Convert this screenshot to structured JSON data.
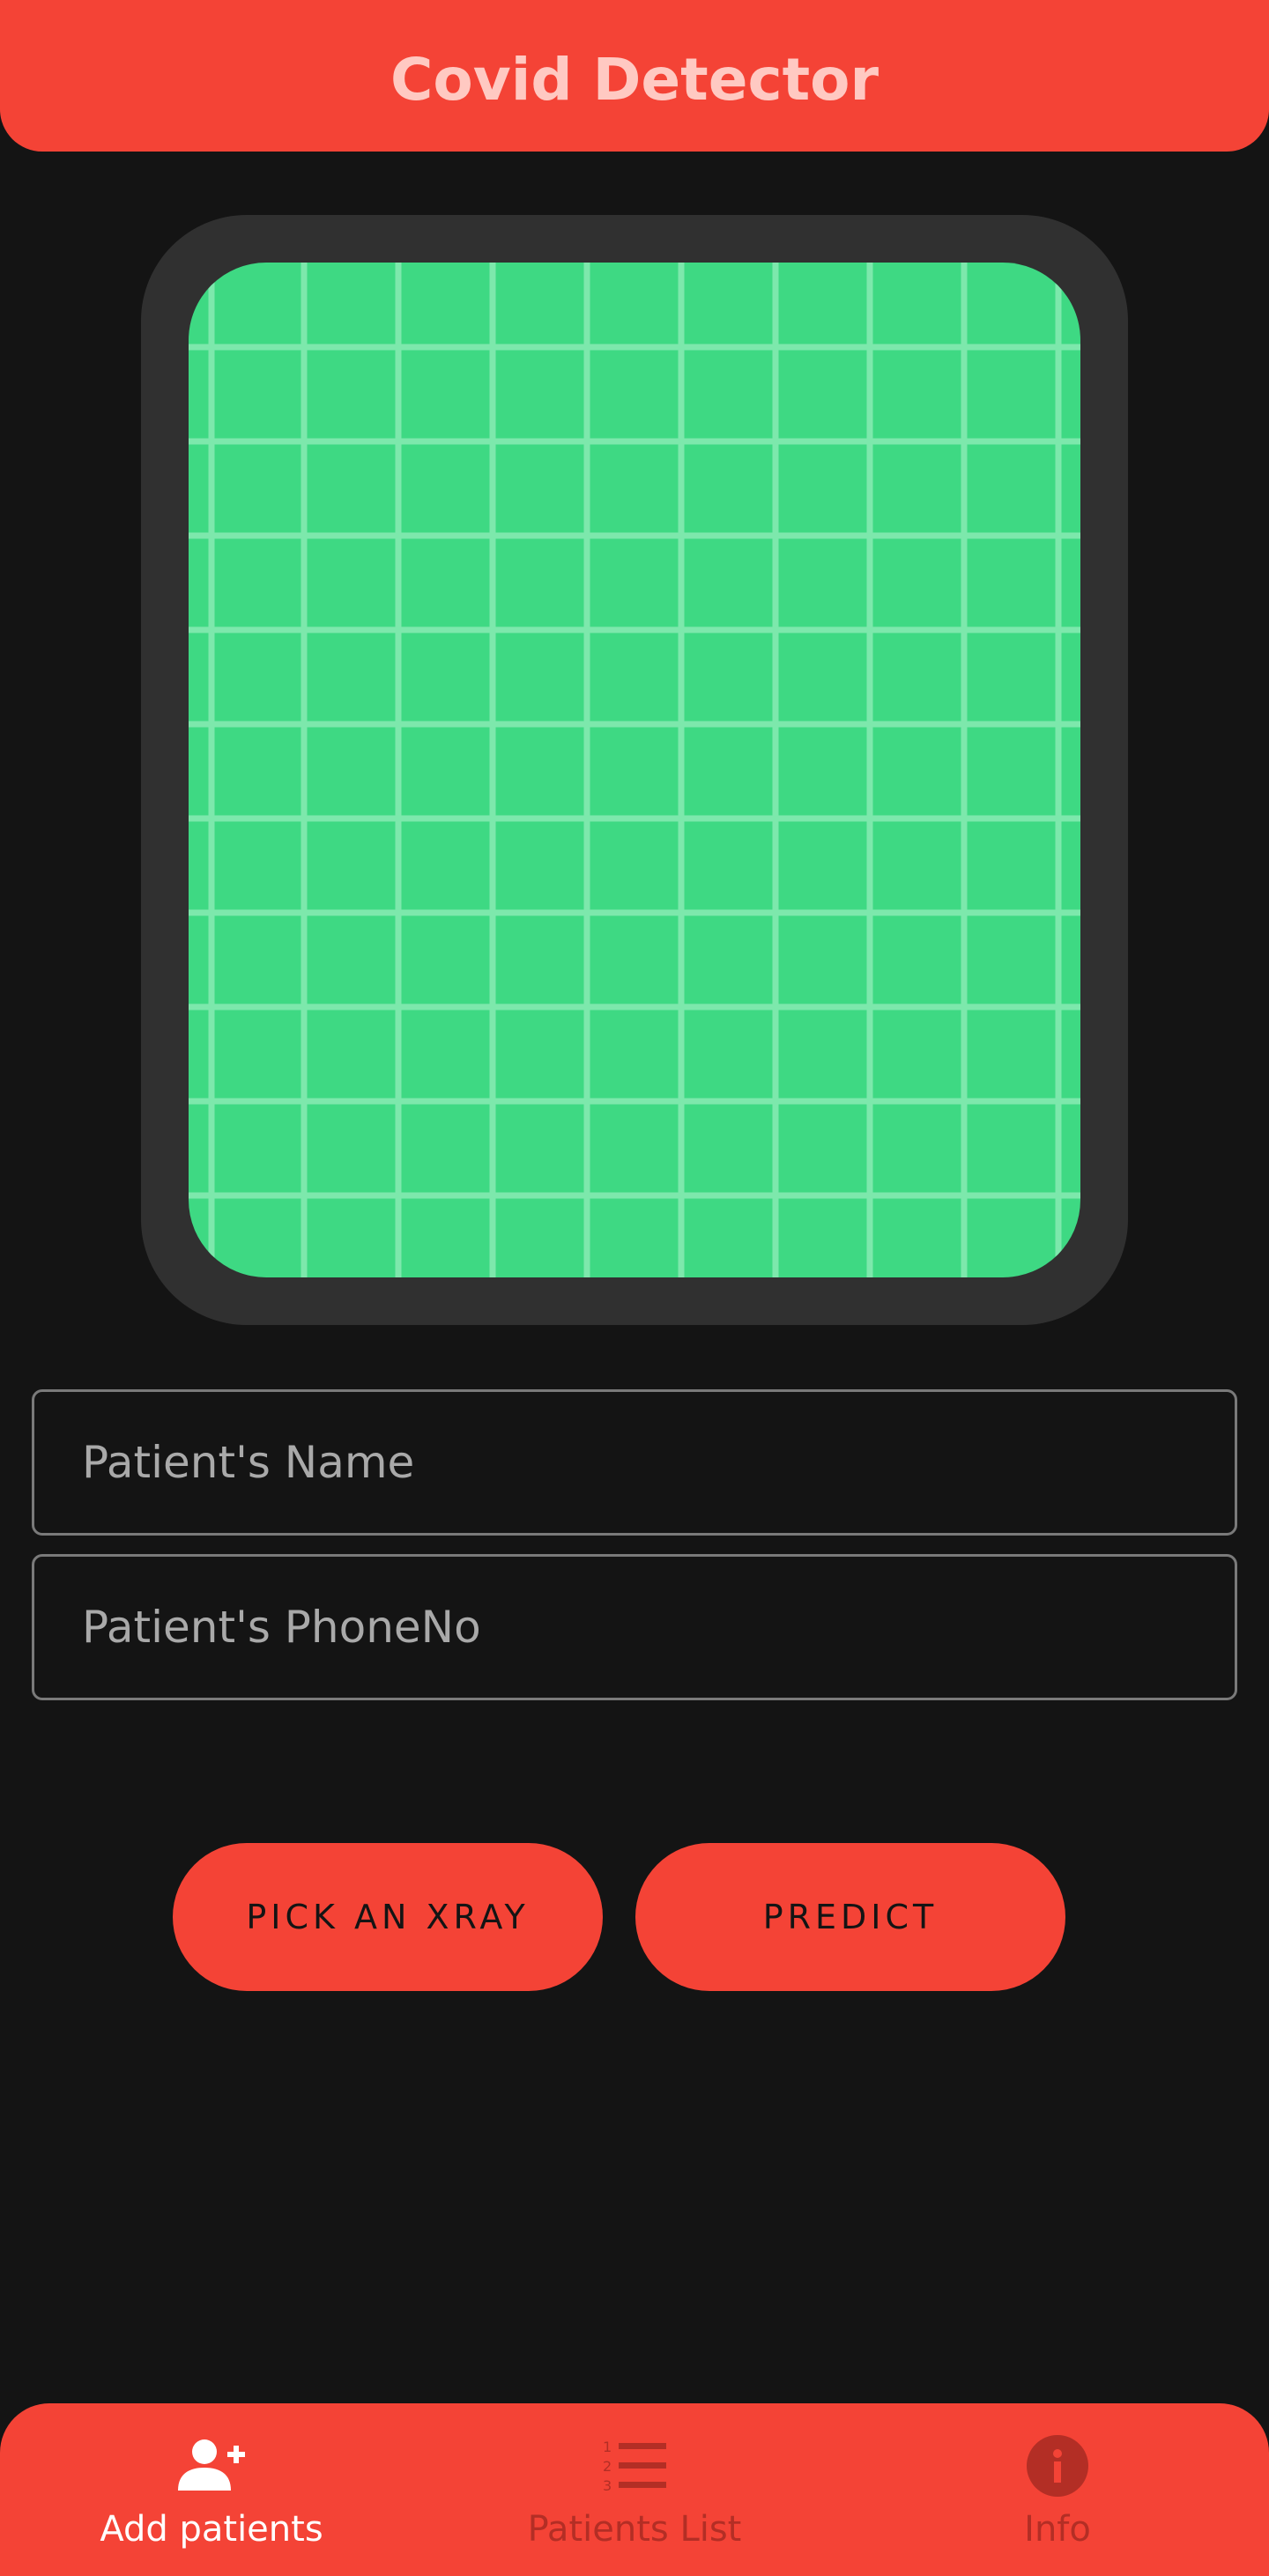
{
  "app_bar": {
    "title": "Covid Detector"
  },
  "form": {
    "name_placeholder": "Patient's Name",
    "phone_placeholder": "Patient's PhoneNo"
  },
  "actions": {
    "pick_label": "PICK AN XRAY",
    "predict_label": "PREDICT"
  },
  "bottom_nav": {
    "items": [
      {
        "label": "Add patients",
        "icon": "add-person-icon",
        "active": true
      },
      {
        "label": "Patients List",
        "icon": "numbered-list-icon",
        "active": false
      },
      {
        "label": "Info",
        "icon": "info-icon",
        "active": false
      }
    ]
  },
  "colors": {
    "accent": "#f44336",
    "background": "#141414",
    "frame": "#303030",
    "placeholder_green": "#3ed983",
    "nav_inactive": "#b32e25"
  }
}
